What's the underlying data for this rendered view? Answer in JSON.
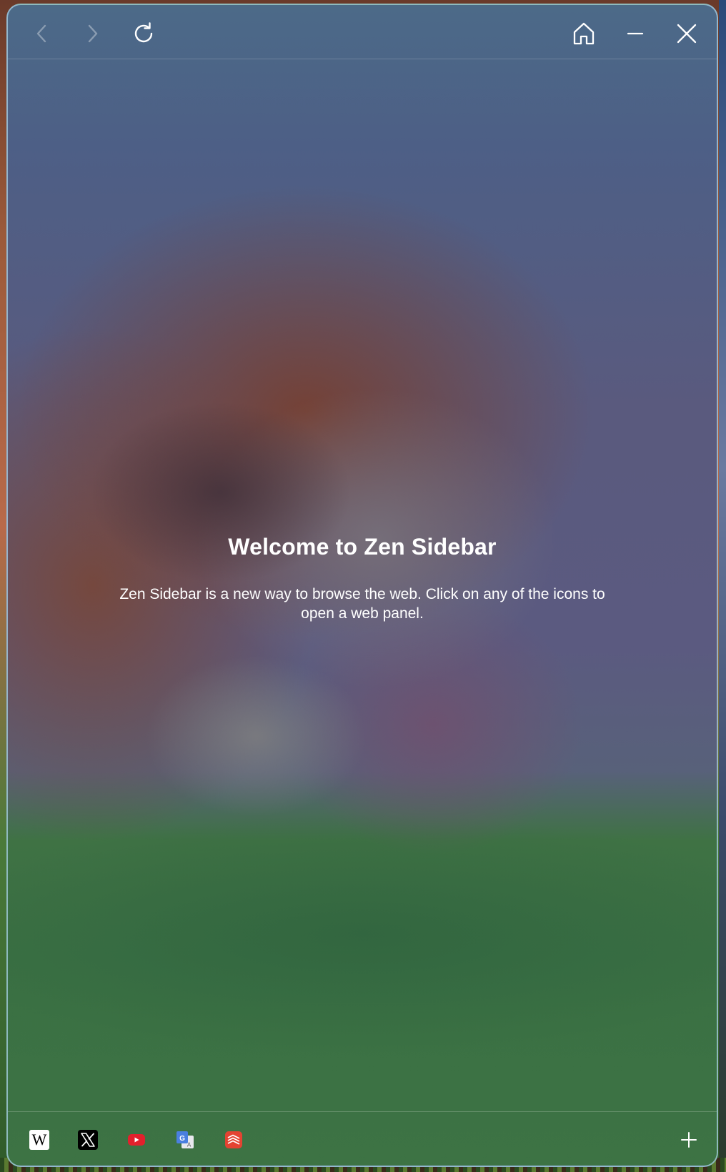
{
  "toolbar": {
    "back_icon": "chevron-left-icon",
    "forward_icon": "chevron-right-icon",
    "reload_icon": "reload-icon",
    "home_icon": "home-icon",
    "minimize_icon": "minimize-icon",
    "close_icon": "close-icon"
  },
  "welcome": {
    "title": "Welcome to Zen Sidebar",
    "description": "Zen Sidebar is a new way to browse the web. Click on any of the icons to open a web panel."
  },
  "bottom_bar": {
    "sites": [
      {
        "name": "Wikipedia",
        "icon": "wikipedia-icon",
        "glyph": "W"
      },
      {
        "name": "X",
        "icon": "x-icon",
        "glyph": "𝕏"
      },
      {
        "name": "YouTube",
        "icon": "youtube-icon"
      },
      {
        "name": "Google Translate",
        "icon": "google-translate-icon",
        "glyph": "G"
      },
      {
        "name": "Todoist",
        "icon": "todoist-icon"
      }
    ],
    "add_icon": "plus-icon"
  },
  "colors": {
    "panel_border": "#aad2e6",
    "text": "#ffffff",
    "youtube_red": "#e3202c",
    "todoist_red": "#e44332",
    "translate_blue": "#4a7fe0"
  }
}
